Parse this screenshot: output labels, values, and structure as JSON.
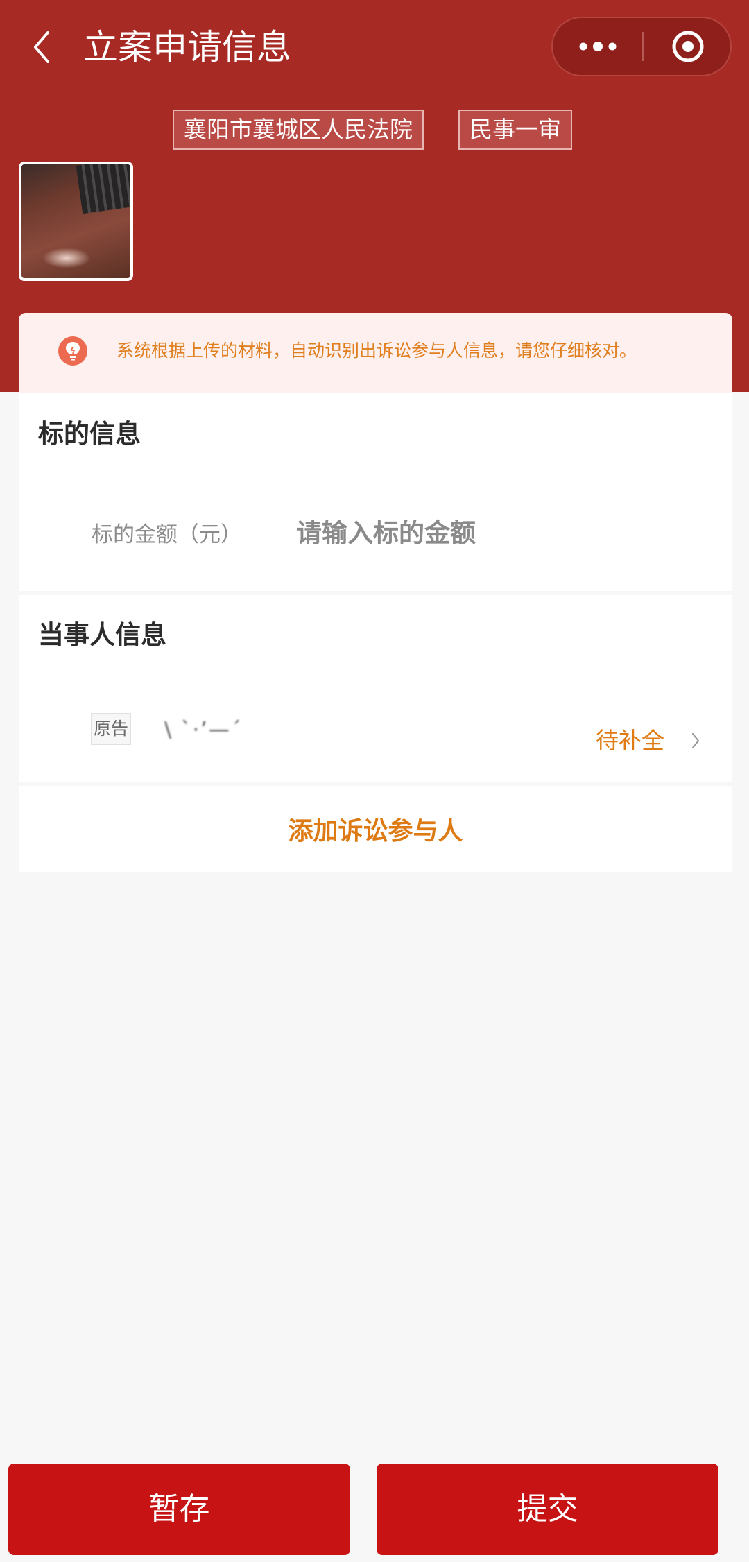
{
  "header": {
    "title": "立案申请信息",
    "back_icon": "chevron-left-icon",
    "capsule": {
      "more_icon": "more-dots-icon",
      "close_icon": "target-circle-icon"
    },
    "court_tag": "襄阳市襄城区人民法院",
    "case_type_tag": "民事一审"
  },
  "notice": {
    "icon": "lightbulb-icon",
    "text": "系统根据上传的材料，自动识别出诉讼参与人信息，请您仔细核对。"
  },
  "subject_section": {
    "title": "标的信息",
    "amount_label": "标的金额（元）",
    "amount_value": "",
    "amount_placeholder": "请输入标的金额"
  },
  "party_section": {
    "title": "当事人信息",
    "parties": [
      {
        "role": "原告",
        "name": "\\ ˋ·ʼ—ˊ",
        "status": "待补全"
      }
    ]
  },
  "add_participant_label": "添加诉讼参与人",
  "actions": {
    "save_label": "暂存",
    "submit_label": "提交"
  },
  "colors": {
    "header_bg": "#a82a25",
    "primary_button": "#c71314",
    "accent_orange": "#e07a12",
    "notice_bg": "#fdf0ee"
  }
}
